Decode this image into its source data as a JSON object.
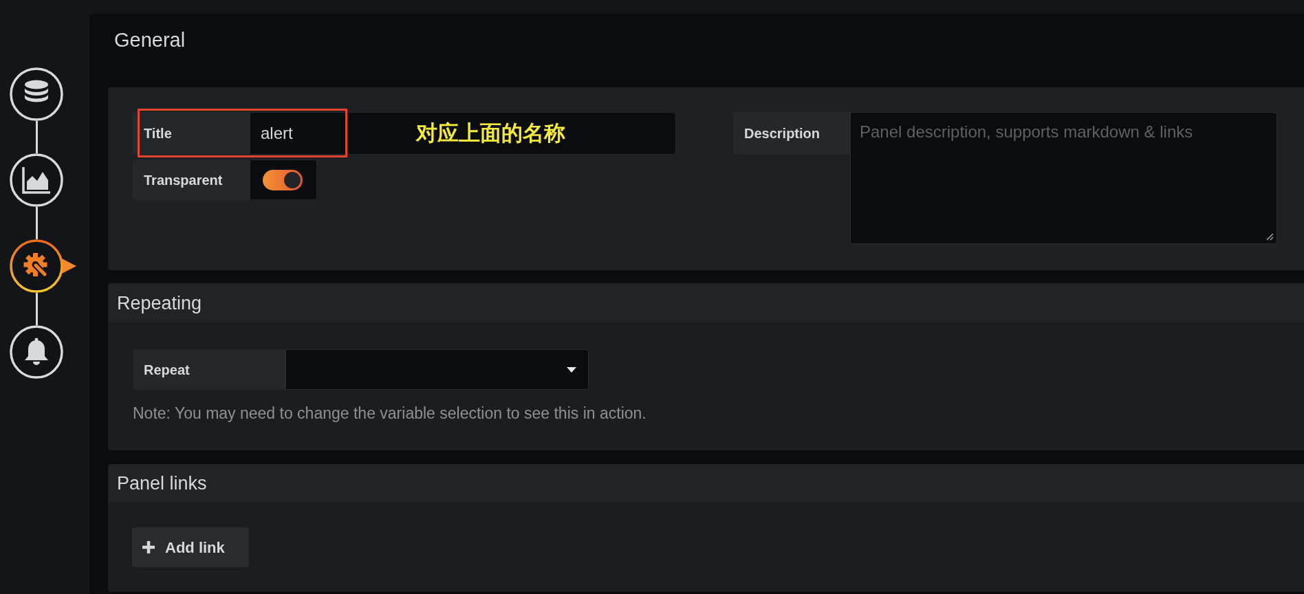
{
  "sidebar": {
    "steps": [
      {
        "kind": "database",
        "selected": false
      },
      {
        "kind": "chart",
        "selected": false
      },
      {
        "kind": "settings",
        "selected": true
      },
      {
        "kind": "alert",
        "selected": false
      }
    ]
  },
  "header": {
    "title": "General"
  },
  "general": {
    "fields": [
      {
        "kind": "text",
        "label": "Title",
        "value": "alert",
        "highlighted": true,
        "annotation": "对应上面的名称"
      },
      {
        "kind": "toggle",
        "label": "Transparent",
        "on": true
      }
    ],
    "description": {
      "label": "Description",
      "placeholder": "Panel description, supports markdown & links"
    }
  },
  "repeating": {
    "title": "Repeating",
    "repeat": {
      "label": "Repeat"
    },
    "note": "Note: You may need to change the variable selection to see this in action."
  },
  "panel_links": {
    "title": "Panel links",
    "add_button": "Add link"
  }
}
